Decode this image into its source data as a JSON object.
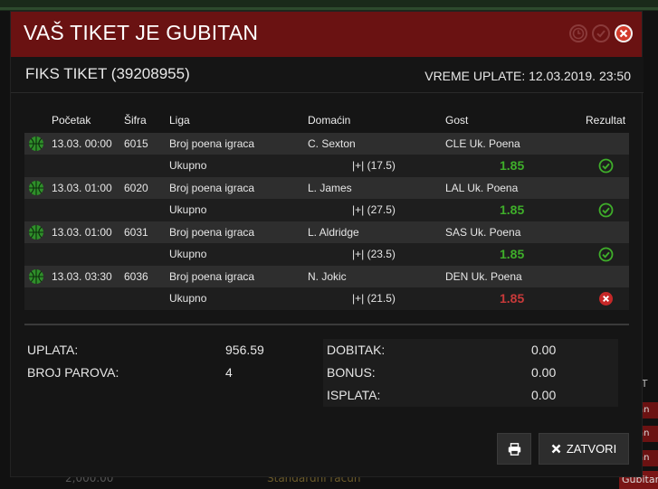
{
  "background": {
    "right_label": "IS T",
    "right_badges": [
      "bitan",
      "bitan",
      "bitan",
      "bitan"
    ],
    "bottom_amount": "2,000.00",
    "bottom_account": "Standardni račun",
    "bottom_badge": "Gubitan"
  },
  "modal": {
    "title": "VAŠ TIKET JE GUBITAN",
    "header_icons": [
      "clock-icon",
      "check-circle-icon",
      "close-icon"
    ],
    "ticket_label": "FIKS TIKET (39208955)",
    "payment_time": "VREME UPLATE: 12.03.2019. 23:50"
  },
  "table": {
    "columns": [
      "Početak",
      "Šifra",
      "Liga",
      "Domaćin",
      "Gost",
      "Rezultat"
    ],
    "rows": [
      {
        "start": "13.03. 00:00",
        "code": "6015",
        "league": "Broj poena igraca",
        "home": "C. Sexton",
        "away": "CLE Uk. Poena",
        "market": "Ukupno",
        "pick": "|+| (17.5)",
        "odd": "1.85",
        "result": "win"
      },
      {
        "start": "13.03. 01:00",
        "code": "6020",
        "league": "Broj poena igraca",
        "home": "L. James",
        "away": "LAL Uk. Poena",
        "market": "Ukupno",
        "pick": "|+| (27.5)",
        "odd": "1.85",
        "result": "win"
      },
      {
        "start": "13.03. 01:00",
        "code": "6031",
        "league": "Broj poena igraca",
        "home": "L. Aldridge",
        "away": "SAS Uk. Poena",
        "market": "Ukupno",
        "pick": "|+| (23.5)",
        "odd": "1.85",
        "result": "win"
      },
      {
        "start": "13.03. 03:30",
        "code": "6036",
        "league": "Broj poena igraca",
        "home": "N. Jokic",
        "away": "DEN Uk. Poena",
        "market": "Ukupno",
        "pick": "|+| (21.5)",
        "odd": "1.85",
        "result": "lose"
      }
    ]
  },
  "summary": {
    "left": [
      {
        "label": "UPLATA:",
        "value": "956.59"
      },
      {
        "label": "BROJ PAROVA:",
        "value": "4"
      }
    ],
    "right": [
      {
        "label": "DOBITAK:",
        "value": "0.00"
      },
      {
        "label": "BONUS:",
        "value": "0.00"
      },
      {
        "label": "ISPLATA:",
        "value": "0.00"
      }
    ]
  },
  "buttons": {
    "print_icon": "print-icon",
    "close_label": "ZATVORI",
    "close_icon": "x-icon"
  },
  "colors": {
    "header_bg": "#6a1212",
    "win": "#3fae2a",
    "lose": "#c83a3a"
  }
}
